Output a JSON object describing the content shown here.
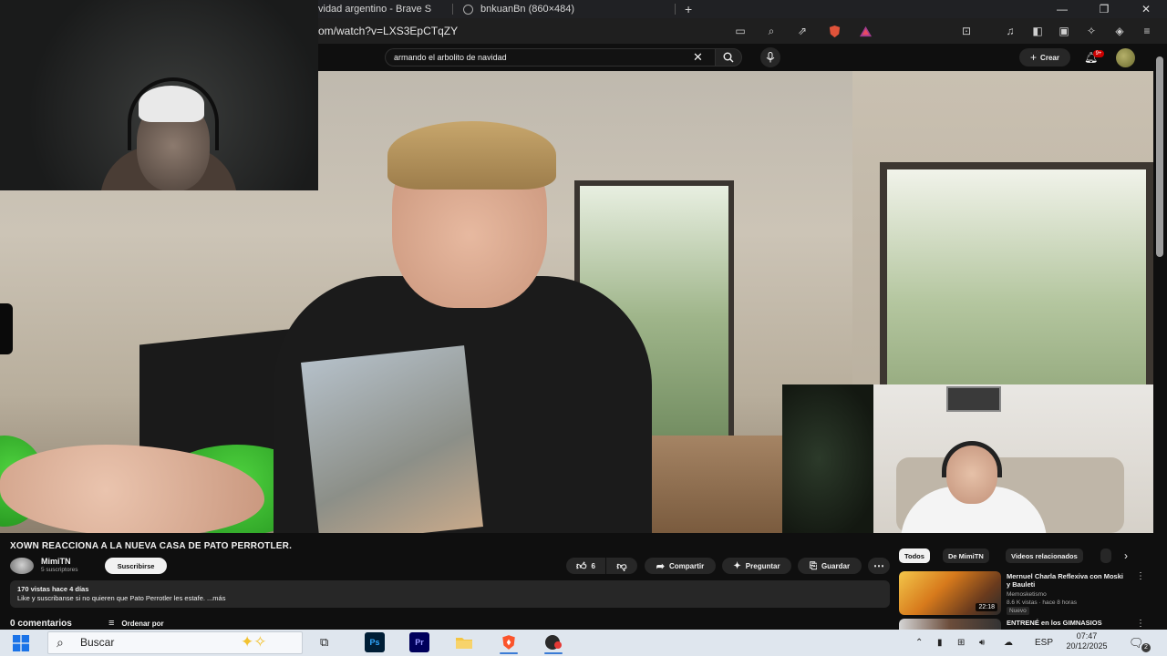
{
  "browser": {
    "tabs": [
      {
        "title": "vidad argentino - Brave S",
        "active": true
      },
      {
        "title": "bnkuanBn (860×484)",
        "active": false
      }
    ],
    "new_tab_icon": "plus-icon",
    "url": "om/watch?v=LXS3EpCTqZY",
    "window_controls": [
      "minimize-icon",
      "restore-icon",
      "close-icon"
    ]
  },
  "youtube": {
    "search": {
      "value": "armando el arbolito de navidad"
    },
    "create_label": "Crear",
    "notifications_badge": "9+"
  },
  "video": {
    "title": "XOWN REACCIONA A LA NUEVA CASA DE PATO PERROTLER.",
    "channel": {
      "name": "MimiTN",
      "subscribers": "5 suscriptores"
    },
    "subscribe_label": "Suscribirse",
    "likes": "6",
    "actions": {
      "share": "Compartir",
      "ask": "Preguntar",
      "save": "Guardar"
    },
    "description": {
      "meta": "170 vistas  hace 4 días",
      "text": "Like y suscribanse si no quieren que Pato Perrotler les estafe. ...más"
    },
    "comments_label": "0 comentarios",
    "sort_label": "Ordenar por"
  },
  "sidebar": {
    "chips": [
      "Todos",
      "De MimiTN",
      "Videos relacionados"
    ],
    "recommendations": [
      {
        "title": "Mernuel Charla Reflexiva con Moski y Bauleti",
        "channel": "Memosketismo",
        "meta": "8.6 K vistas · hace 8 horas",
        "badge": "Nuevo",
        "duration": "22:18"
      },
      {
        "title": "ENTRENÉ en los GIMNASIOS",
        "channel": "",
        "meta": "",
        "badge": "",
        "duration": ""
      }
    ]
  },
  "taskbar": {
    "search_placeholder": "Buscar",
    "apps": [
      "Ps",
      "Pr"
    ],
    "language": "ESP",
    "time": "07:47",
    "date": "20/12/2025",
    "notification_count": "2"
  },
  "colors": {
    "yt_background": "#0f0f0f",
    "chip_active": "#f1f1f1",
    "badge_red": "#cc0000",
    "taskbar": "#dfe6ee"
  }
}
